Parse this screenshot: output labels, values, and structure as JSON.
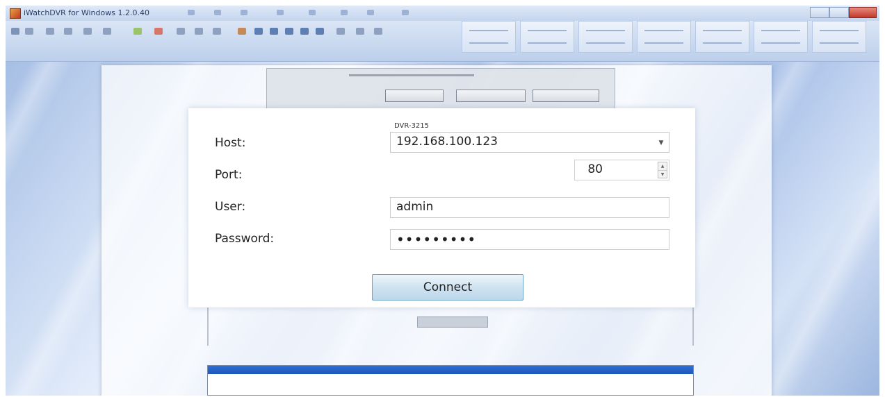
{
  "window": {
    "title": "iWatchDVR for Windows 1.2.0.40"
  },
  "dialog": {
    "device_name": "DVR-3215",
    "host_label": "Host:",
    "host_value": "192.168.100.123",
    "port_label": "Port:",
    "port_value": "80",
    "user_label": "User:",
    "user_value": "admin",
    "password_label": "Password:",
    "password_value": "•••••••••",
    "connect_label": "Connect"
  },
  "icons": {
    "app": "app-icon",
    "host_dropdown": "chevron-down-icon",
    "port_up": "spinner-up-icon",
    "port_down": "spinner-down-icon"
  }
}
